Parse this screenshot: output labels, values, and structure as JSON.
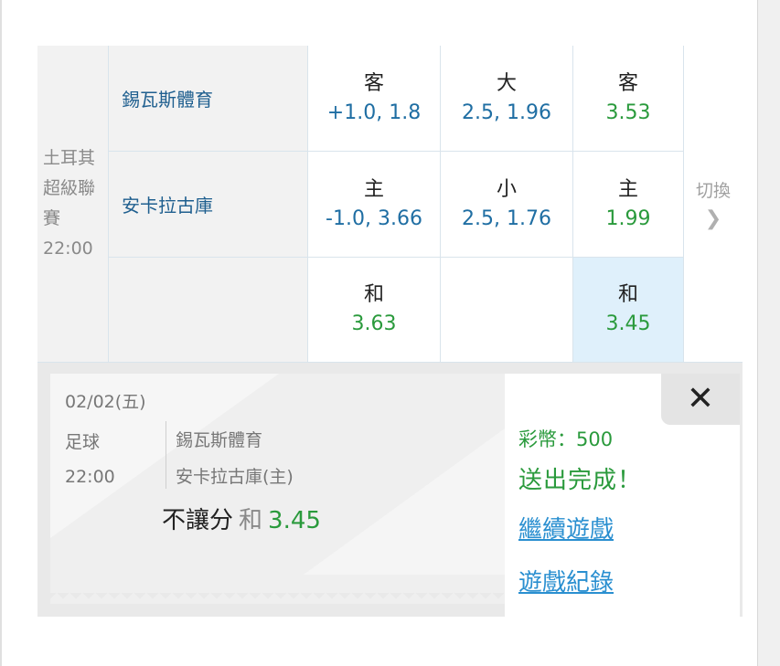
{
  "league": {
    "line1": "土耳其",
    "line2": "超級聯",
    "line3": "賽",
    "time": "22:00"
  },
  "teams": {
    "away": "錫瓦斯體育",
    "home": "安卡拉古庫"
  },
  "odds": {
    "row1": [
      {
        "label": "客",
        "value": "+1.0, 1.8",
        "color": "#1f6ea3"
      },
      {
        "label": "大",
        "value": "2.5, 1.96",
        "color": "#1f6ea3"
      },
      {
        "label": "客",
        "value": "3.53",
        "color": "#2a9a3c"
      }
    ],
    "row2": [
      {
        "label": "主",
        "value": "-1.0, 3.66",
        "color": "#1f6ea3"
      },
      {
        "label": "小",
        "value": "2.5, 1.76",
        "color": "#1f6ea3"
      },
      {
        "label": "主",
        "value": "1.99",
        "color": "#2a9a3c"
      }
    ],
    "row3": [
      {
        "label": "和",
        "value": "3.63",
        "color": "#2a9a3c"
      },
      {
        "label": "和",
        "value": "3.45",
        "color": "#2a9a3c",
        "selected": true
      }
    ]
  },
  "switch_label": "切換",
  "ticket": {
    "date": "02/02(五)",
    "sport": "足球",
    "time": "22:00",
    "team1": "錫瓦斯體育",
    "team2": "安卡拉古庫(主)",
    "market": "不讓分",
    "selection": "和",
    "price": "3.45"
  },
  "panel": {
    "credit": "彩幣：500",
    "status": "送出完成！",
    "continue_link": "繼續遊戲",
    "history_link": "遊戲紀錄"
  },
  "icons": {
    "close": "close-icon",
    "chevron": "chevron-right-icon"
  }
}
